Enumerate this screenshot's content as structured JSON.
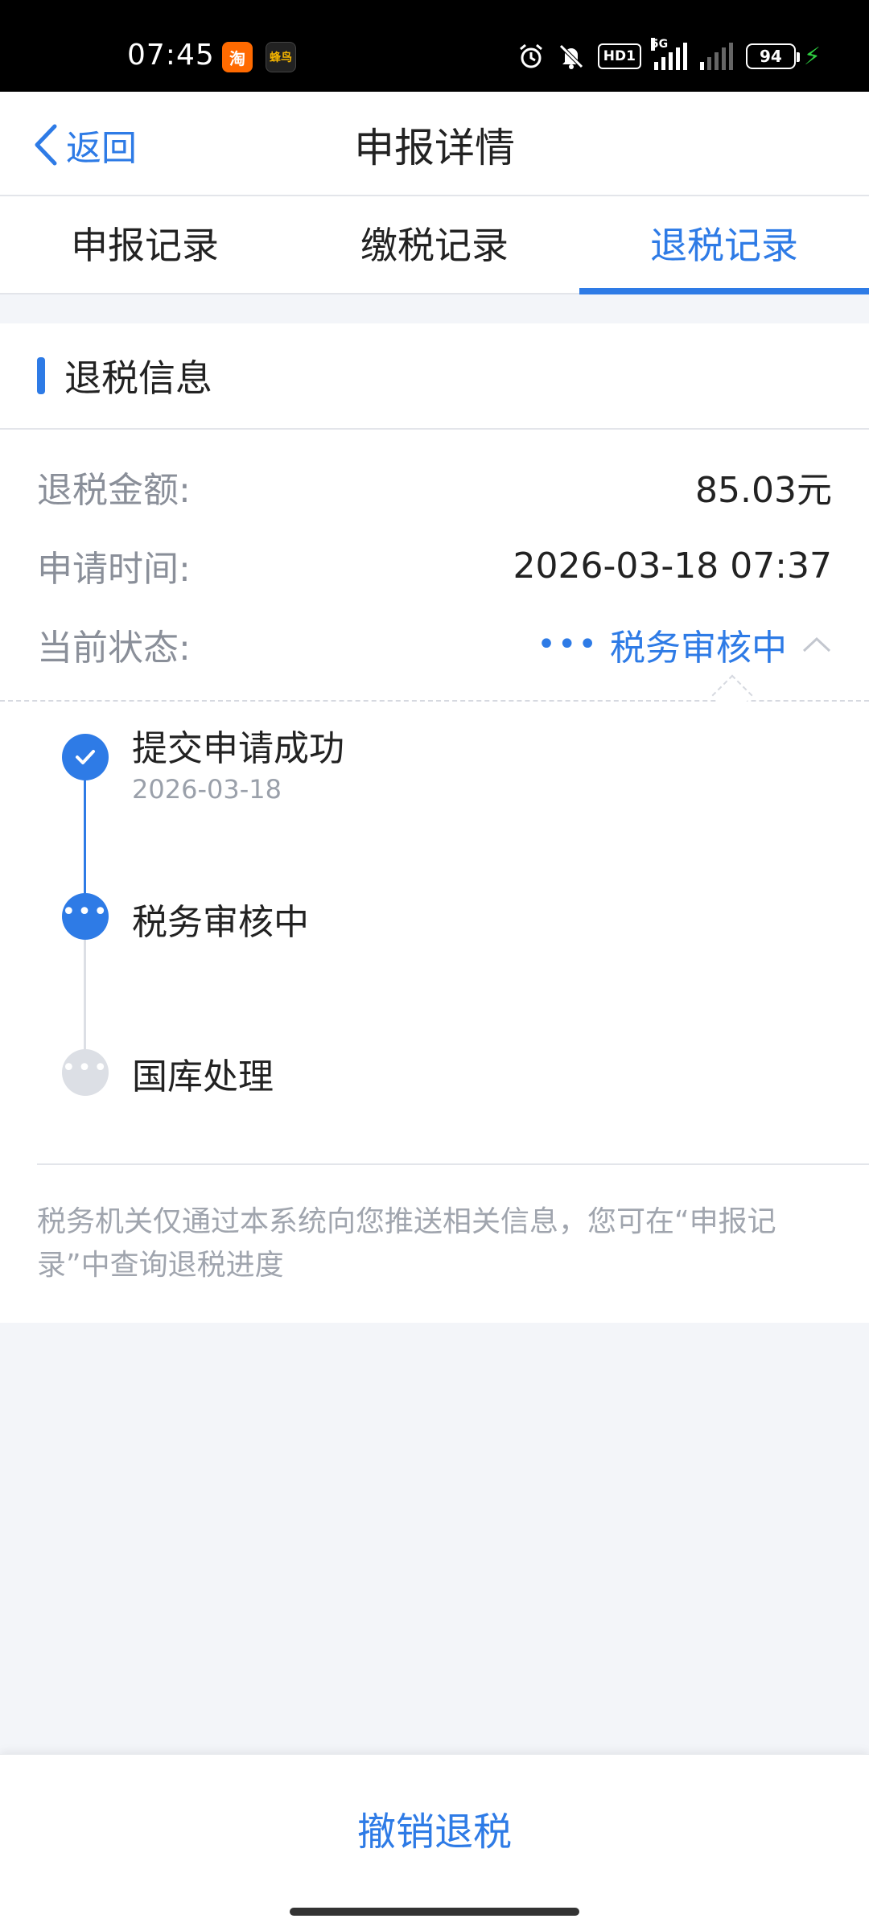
{
  "status_bar": {
    "time": "07:45",
    "app1": "淘",
    "app2": "蜂鸟",
    "hd": "HD1",
    "signal_label": "5G",
    "battery": "94",
    "icons": [
      "alarm-icon",
      "mute-icon",
      "hd-icon",
      "signal-5g-icon",
      "signal-icon",
      "battery-icon",
      "charging-icon"
    ]
  },
  "nav": {
    "back_label": "返回",
    "title": "申报详情"
  },
  "tabs": [
    {
      "label": "申报记录",
      "active": false
    },
    {
      "label": "缴税记录",
      "active": false
    },
    {
      "label": "退税记录",
      "active": true
    }
  ],
  "section": {
    "title": "退税信息"
  },
  "info": {
    "amount_label": "退税金额:",
    "amount_value": "85.03元",
    "time_label": "申请时间:",
    "time_value": "2026-03-18 07:37",
    "status_label": "当前状态:",
    "status_dots": "•••",
    "status_value": "税务审核中"
  },
  "timeline": [
    {
      "title": "提交申请成功",
      "date": "2026-03-18",
      "state": "done"
    },
    {
      "title": "税务审核中",
      "date": "",
      "state": "current"
    },
    {
      "title": "国库处理",
      "date": "",
      "state": "pending"
    }
  ],
  "note": "税务机关仅通过本系统向您推送相关信息，您可在“申报记录”中查询退税进度",
  "bottom": {
    "cancel_label": "撤销退税"
  },
  "colors": {
    "accent": "#2e7be6",
    "pending": "#dcdfe5",
    "background": "#f3f5f9"
  }
}
